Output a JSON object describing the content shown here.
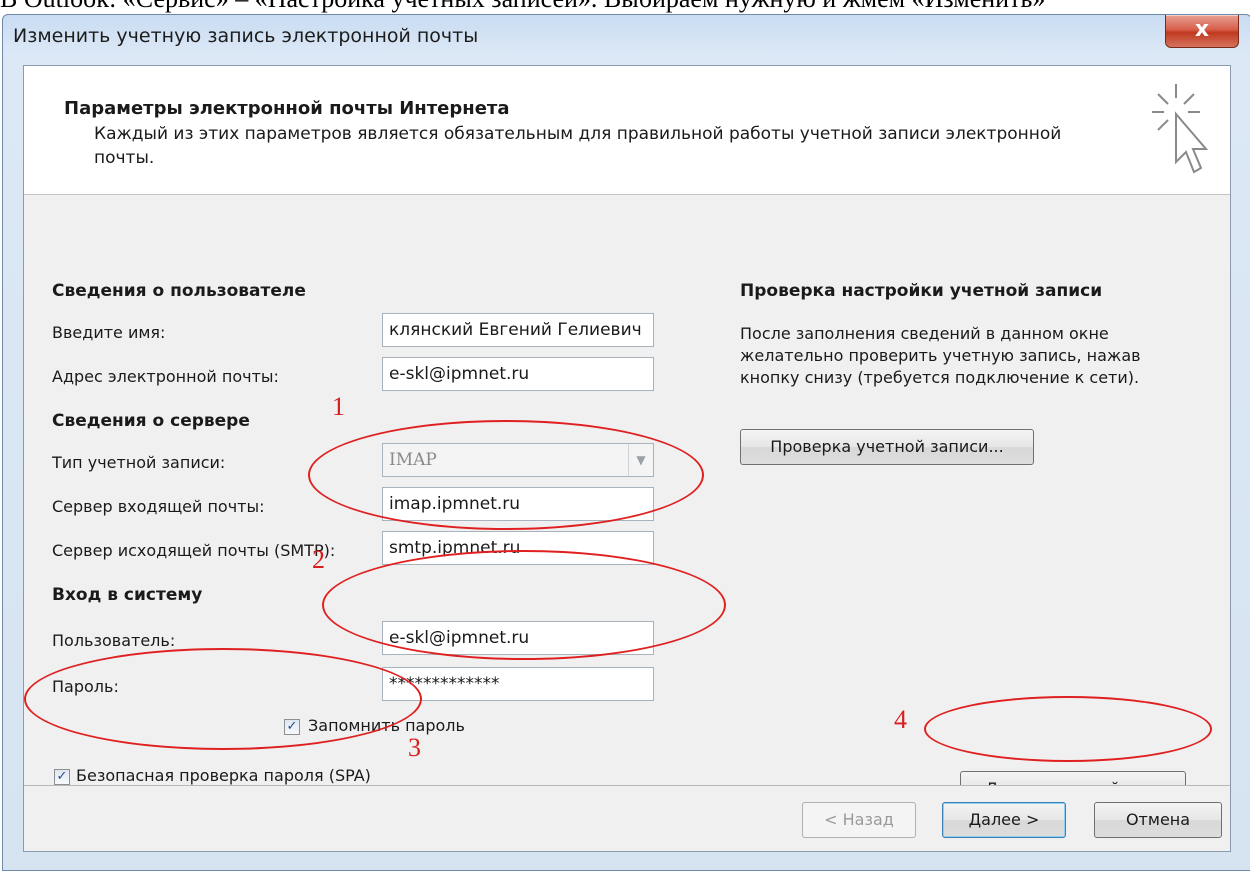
{
  "document": {
    "top_text": "В Outlook: «Сервис» – «Настройка учетных записей». Выбираем нужную и жмем «Изменить»"
  },
  "window": {
    "title": "Изменить учетную запись электронной почты",
    "close_glyph": "x"
  },
  "header": {
    "title": "Параметры электронной почты Интернета",
    "description": "Каждый из этих параметров является обязательным для правильной работы учетной записи электронной почты."
  },
  "user_info": {
    "section_title": "Сведения о пользователе",
    "name_label": "Введите имя:",
    "name_value": "клянский Евгений Гелиевич",
    "email_label": "Адрес электронной почты:",
    "email_value": "e-skl@ipmnet.ru"
  },
  "server_info": {
    "section_title": "Сведения о сервере",
    "account_type_label": "Тип учетной записи:",
    "account_type_value": "IMAP",
    "incoming_label": "Сервер входящей почты:",
    "incoming_value": "imap.ipmnet.ru",
    "outgoing_label": "Сервер исходящей почты (SMTP):",
    "outgoing_value": "smtp.ipmnet.ru"
  },
  "login": {
    "section_title": "Вход в систему",
    "user_label": "Пользователь:",
    "user_value": "e-skl@ipmnet.ru",
    "password_label": "Пароль:",
    "password_value": "*************",
    "remember_label": "Запомнить пароль",
    "remember_checked": true,
    "spa_label": "Безопасная проверка пароля (SPA)",
    "spa_checked": true
  },
  "test_settings": {
    "section_title": "Проверка настройки учетной записи",
    "description": "После заполнения сведений в данном окне желательно проверить учетную запись, нажав кнопку снизу (требуется подключение к сети).",
    "test_button": "Проверка учетной записи...",
    "more_settings_button": "Другие настройки ..."
  },
  "footer": {
    "back_button": "< Назад",
    "next_button": "Далее >",
    "cancel_button": "Отмена"
  },
  "annotations": {
    "note_1": "1",
    "note_2": "2",
    "note_3": "3",
    "note_4": "4",
    "color": "#e02020"
  },
  "icons": {
    "checkbox_check": "✓",
    "dropdown_arrow": "▼"
  }
}
